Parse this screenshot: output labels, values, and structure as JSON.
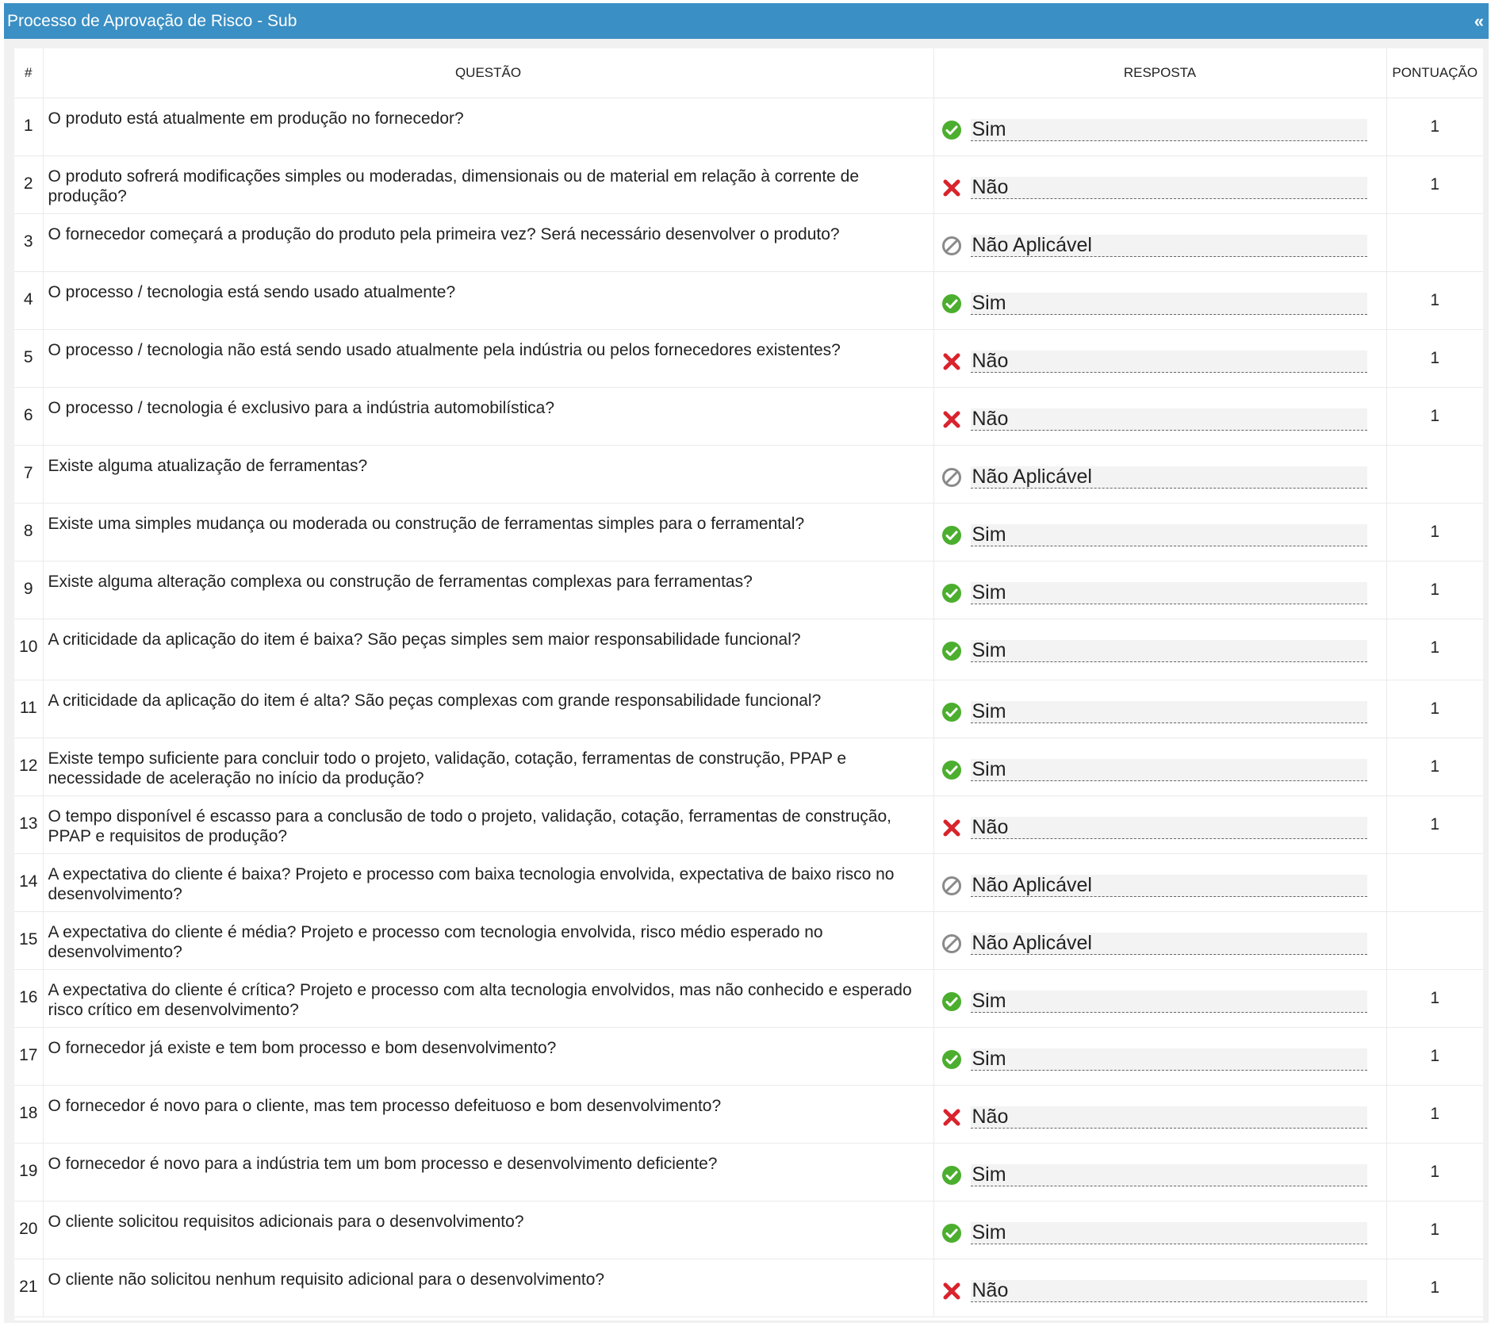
{
  "panel": {
    "title": "Processo de Aprovação de Risco - Sub",
    "collapse_label": "«"
  },
  "table": {
    "headers": {
      "num": "#",
      "question": "QUESTÃO",
      "answer": "RESPOSTA",
      "score": "PONTUAÇÃO"
    },
    "rows": [
      {
        "num": "1",
        "question": "O produto está atualmente em produção no fornecedor?",
        "answer": "Sim",
        "answer_type": "yes",
        "score": "1"
      },
      {
        "num": "2",
        "question": "O produto sofrerá modificações simples ou moderadas, dimensionais ou de material em relação à corrente de produção?",
        "answer": "Não",
        "answer_type": "no",
        "score": "1"
      },
      {
        "num": "3",
        "question": "O fornecedor começará a produção do produto pela primeira vez? Será necessário desenvolver o produto?",
        "answer": "Não Aplicável",
        "answer_type": "na",
        "score": ""
      },
      {
        "num": "4",
        "question": "O processo / tecnologia está sendo usado atualmente?",
        "answer": "Sim",
        "answer_type": "yes",
        "score": "1"
      },
      {
        "num": "5",
        "question": "O processo / tecnologia não está sendo usado atualmente pela indústria ou pelos fornecedores existentes?",
        "answer": "Não",
        "answer_type": "no",
        "score": "1"
      },
      {
        "num": "6",
        "question": "O processo / tecnologia é exclusivo para a indústria automobilística?",
        "answer": "Não",
        "answer_type": "no",
        "score": "1"
      },
      {
        "num": "7",
        "question": "Existe alguma atualização de ferramentas?",
        "answer": "Não Aplicável",
        "answer_type": "na",
        "score": ""
      },
      {
        "num": "8",
        "question": "Existe uma simples mudança ou moderada ou construção de ferramentas simples para o ferramental?",
        "answer": "Sim",
        "answer_type": "yes",
        "score": "1"
      },
      {
        "num": "9",
        "question": "Existe alguma alteração complexa ou construção de ferramentas complexas para ferramentas?",
        "answer": "Sim",
        "answer_type": "yes",
        "score": "1"
      },
      {
        "num": "10",
        "question": "A criticidade da aplicação do item é baixa? São peças simples sem maior responsabilidade funcional?",
        "answer": "Sim",
        "answer_type": "yes",
        "score": "1"
      },
      {
        "num": "11",
        "question": "A criticidade da aplicação do item é alta? São peças complexas com grande responsabilidade funcional?",
        "answer": "Sim",
        "answer_type": "yes",
        "score": "1"
      },
      {
        "num": "12",
        "question": "Existe tempo suficiente para concluir todo o projeto, validação, cotação, ferramentas de construção, PPAP e necessidade de aceleração no início da produção?",
        "answer": "Sim",
        "answer_type": "yes",
        "score": "1"
      },
      {
        "num": "13",
        "question": "O tempo disponível é escasso para a conclusão de todo o projeto, validação, cotação, ferramentas de construção, PPAP e requisitos de produção?",
        "answer": "Não",
        "answer_type": "no",
        "score": "1"
      },
      {
        "num": "14",
        "question": "A expectativa do cliente é baixa? Projeto e processo com baixa tecnologia envolvida, expectativa de baixo risco no desenvolvimento?",
        "answer": "Não Aplicável",
        "answer_type": "na",
        "score": ""
      },
      {
        "num": "15",
        "question": "A expectativa do cliente é média? Projeto e processo com tecnologia envolvida, risco médio esperado no desenvolvimento?",
        "answer": "Não Aplicável",
        "answer_type": "na",
        "score": ""
      },
      {
        "num": "16",
        "question": "A expectativa do cliente é crítica? Projeto e processo com alta tecnologia envolvidos, mas não conhecido e esperado risco crítico em desenvolvimento?",
        "answer": "Sim",
        "answer_type": "yes",
        "score": "1"
      },
      {
        "num": "17",
        "question": "O fornecedor já existe e tem bom processo e bom desenvolvimento?",
        "answer": "Sim",
        "answer_type": "yes",
        "score": "1"
      },
      {
        "num": "18",
        "question": "O fornecedor é novo para o cliente, mas tem processo defeituoso e bom desenvolvimento?",
        "answer": "Não",
        "answer_type": "no",
        "score": "1"
      },
      {
        "num": "19",
        "question": "O fornecedor é novo para a indústria tem um bom processo e desenvolvimento deficiente?",
        "answer": "Sim",
        "answer_type": "yes",
        "score": "1"
      },
      {
        "num": "20",
        "question": "O cliente solicitou requisitos adicionais para o desenvolvimento?",
        "answer": "Sim",
        "answer_type": "yes",
        "score": "1"
      },
      {
        "num": "21",
        "question": "O cliente não solicitou nenhum requisito adicional para o desenvolvimento?",
        "answer": "Não",
        "answer_type": "no",
        "score": "1"
      }
    ]
  },
  "icons": {
    "yes": "check-circle-icon",
    "no": "red-x-icon",
    "na": "not-applicable-icon"
  },
  "colors": {
    "header_bg": "#3a8fc4",
    "yes": "#4cae2e",
    "no": "#d9232d",
    "na": "#8a8a8a"
  }
}
